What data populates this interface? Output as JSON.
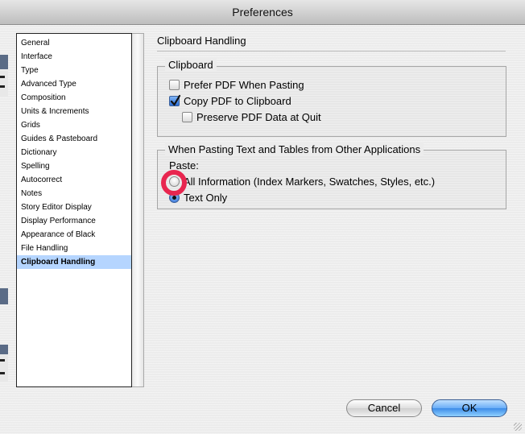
{
  "window": {
    "title": "Preferences"
  },
  "sidebar": {
    "items": [
      {
        "label": "General",
        "selected": false
      },
      {
        "label": "Interface",
        "selected": false
      },
      {
        "label": "Type",
        "selected": false
      },
      {
        "label": "Advanced Type",
        "selected": false
      },
      {
        "label": "Composition",
        "selected": false
      },
      {
        "label": "Units & Increments",
        "selected": false
      },
      {
        "label": "Grids",
        "selected": false
      },
      {
        "label": "Guides & Pasteboard",
        "selected": false
      },
      {
        "label": "Dictionary",
        "selected": false
      },
      {
        "label": "Spelling",
        "selected": false
      },
      {
        "label": "Autocorrect",
        "selected": false
      },
      {
        "label": "Notes",
        "selected": false
      },
      {
        "label": "Story Editor Display",
        "selected": false
      },
      {
        "label": "Display Performance",
        "selected": false
      },
      {
        "label": "Appearance of Black",
        "selected": false
      },
      {
        "label": "File Handling",
        "selected": false
      },
      {
        "label": "Clipboard Handling",
        "selected": true
      }
    ]
  },
  "panel": {
    "title": "Clipboard Handling",
    "clipboard_group": {
      "legend": "Clipboard",
      "options": [
        {
          "label": "Prefer PDF When Pasting",
          "checked": false
        },
        {
          "label": "Copy PDF to Clipboard",
          "checked": true
        },
        {
          "label": "Preserve PDF Data at Quit",
          "checked": false
        }
      ]
    },
    "pasting_group": {
      "legend": "When Pasting Text and Tables from Other Applications",
      "paste_label": "Paste:",
      "options": [
        {
          "label": "All Information (Index Markers, Swatches, Styles, etc.)",
          "selected": false
        },
        {
          "label": "Text Only",
          "selected": true
        }
      ]
    }
  },
  "buttons": {
    "cancel_label": "Cancel",
    "ok_label": "OK"
  },
  "colors": {
    "selection": "#b5d5ff",
    "highlight_ring": "#e8264f",
    "default_button": "#3d8ce8"
  }
}
